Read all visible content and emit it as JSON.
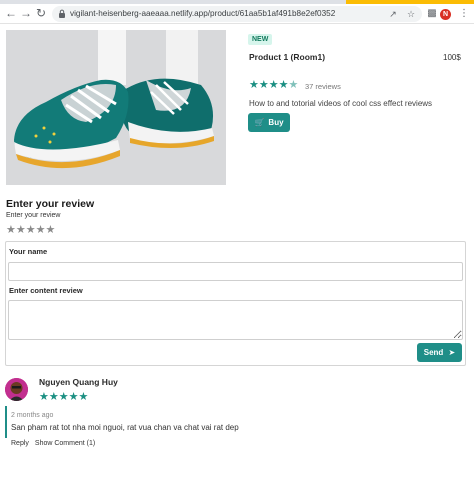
{
  "browser": {
    "url": "vigilant-heisenberg-aaeaaa.netlify.app/product/61aa5b1af491b8e2ef0352",
    "profile_initial": "N"
  },
  "product": {
    "badge": "NEW",
    "title": "Product 1 (Room1)",
    "price": "100$",
    "rating": 4.5,
    "reviews_count": "37 reviews",
    "description": "How to and totorial videos of cool css effect reviews",
    "buy_label": "Buy"
  },
  "review_form": {
    "heading": "Enter your review",
    "subheading": "Enter your review",
    "rating": 0,
    "name_label": "Your name",
    "name_value": "",
    "content_label": "Enter content review",
    "content_value": "",
    "send_label": "Send"
  },
  "comments": [
    {
      "author": "Nguyen Quang Huy",
      "rating": 5,
      "time": "2 months ago",
      "text": "San pham rat tot nha moi nguoi, rat vua chan va chat vai rat dep",
      "reply_label": "Reply",
      "show_comment_label": "Show Comment (1)"
    }
  ],
  "colors": {
    "accent": "#1f8e88",
    "star_filled": "#1a8f82",
    "star_empty": "#8a8a8a",
    "badge_bg": "#d6f5ec",
    "avatar_bg": "#c22f8f"
  }
}
